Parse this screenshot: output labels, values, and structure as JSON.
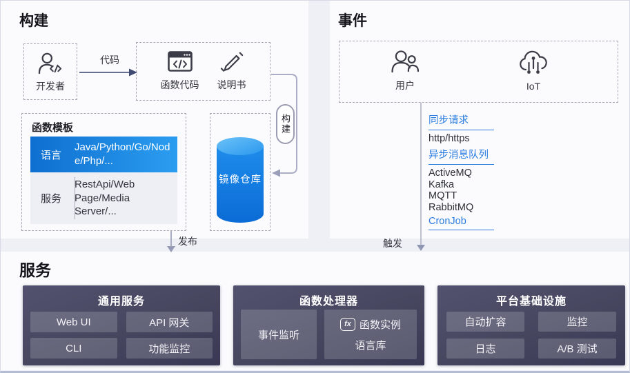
{
  "build_section": {
    "title": "构建",
    "developer": {
      "label": "开发者"
    },
    "code_arrow_label": "代码",
    "function_box": {
      "code_label": "函数代码",
      "manual_label": "说明书"
    },
    "template": {
      "title": "函数模板",
      "rows": [
        {
          "label": "语言",
          "value": "Java/Python/Go/Node/Php/..."
        },
        {
          "label": "服务",
          "value": "RestApi/Web Page/Media Server/..."
        }
      ]
    },
    "registry": {
      "label": "镜像仓库"
    },
    "build_pill_label": "构建",
    "publish_label": "发布"
  },
  "events_section": {
    "title": "事件",
    "sources": [
      {
        "label": "用户"
      },
      {
        "label": "IoT"
      }
    ],
    "groups": [
      {
        "heading": "同步请求",
        "items": [
          "http/https"
        ]
      },
      {
        "heading": "异步消息队列",
        "items": [
          "ActiveMQ",
          "Kafka",
          "MQTT",
          "RabbitMQ"
        ]
      },
      {
        "heading": "CronJob",
        "items": []
      }
    ],
    "trigger_label": "触发"
  },
  "services_section": {
    "title": "服务",
    "panels": [
      {
        "title": "通用服务",
        "buttons": [
          "Web UI",
          "API 网关",
          "CLI",
          "功能监控"
        ]
      },
      {
        "title": "函数处理器",
        "buttons": [
          "事件监听",
          "函数实例",
          "语言库"
        ],
        "fx_icon_text": "fx"
      },
      {
        "title": "平台基础设施",
        "buttons": [
          "自动扩容",
          "监控",
          "日志",
          "A/B 测试"
        ]
      }
    ]
  },
  "colors": {
    "table_blue_start": "#0e6fd0",
    "table_blue_end": "#2b9df0",
    "cylinder_blue_top": "#63bdf6",
    "cylinder_blue_body": "#0b6bd6",
    "link_blue": "#2a7ce0",
    "panel_dark": "#46465f",
    "panel_button": "#5d5d78",
    "connector_gray": "#aaadc5",
    "code_arrow_dark": "#3f4a73"
  }
}
